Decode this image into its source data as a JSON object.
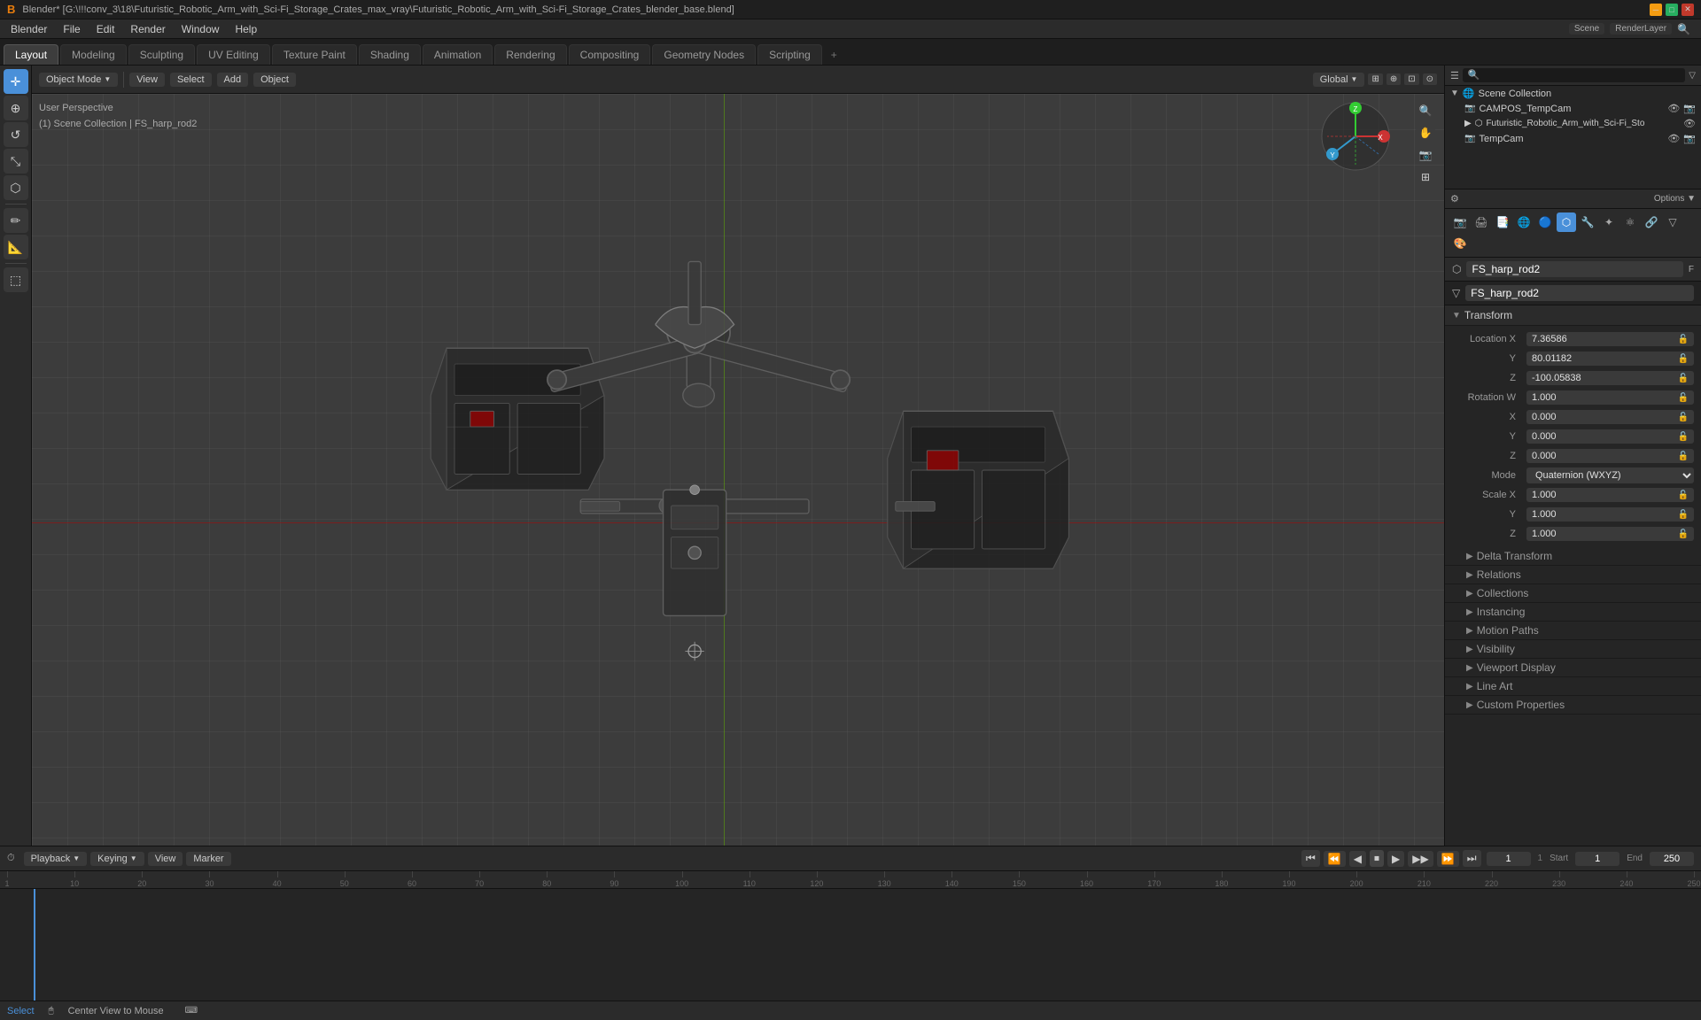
{
  "titlebar": {
    "logo": "B",
    "title": "Blender* [G:\\!!!conv_3\\18\\Futuristic_Robotic_Arm_with_Sci-Fi_Storage_Crates_max_vray\\Futuristic_Robotic_Arm_with_Sci-Fi_Storage_Crates_blender_base.blend]",
    "scene_label": "Scene",
    "render_layer": "RenderLayer"
  },
  "menubar": {
    "items": [
      "Blender",
      "File",
      "Edit",
      "Render",
      "Window",
      "Help"
    ]
  },
  "workspace_tabs": {
    "tabs": [
      "Layout",
      "Modeling",
      "Sculpting",
      "UV Editing",
      "Texture Paint",
      "Shading",
      "Animation",
      "Rendering",
      "Compositing",
      "Geometry Nodes",
      "Scripting"
    ],
    "active": "Layout",
    "add_label": "+"
  },
  "viewport_header": {
    "mode": "Object Mode",
    "view_label": "View",
    "select_label": "Select",
    "add_label": "Add",
    "object_label": "Object",
    "global_label": "Global",
    "perspective": "User Perspective",
    "collection": "(1) Scene Collection | FS_harp_rod2"
  },
  "left_toolbar": {
    "tools": [
      {
        "name": "cursor-tool",
        "icon": "✛",
        "active": true
      },
      {
        "name": "move-tool",
        "icon": "⊕",
        "active": false
      },
      {
        "name": "rotate-tool",
        "icon": "↺",
        "active": false
      },
      {
        "name": "scale-tool",
        "icon": "⤡",
        "active": false
      },
      {
        "name": "transform-tool",
        "icon": "⬡",
        "active": false
      },
      {
        "name": "annotate-tool",
        "icon": "✏",
        "active": false
      },
      {
        "name": "measure-tool",
        "icon": "📏",
        "active": false
      },
      {
        "name": "add-tool",
        "icon": "+",
        "active": false
      }
    ]
  },
  "outliner": {
    "search_placeholder": "🔍",
    "items": [
      {
        "name": "Scene Collection",
        "indent": 0,
        "icon": "📁",
        "has_eye": true,
        "has_cam": false
      },
      {
        "name": "CAMPOS_TempCam",
        "indent": 1,
        "icon": "📷",
        "has_eye": true,
        "has_cam": true
      },
      {
        "name": "Futuristic_Robotic_Arm_with_Sci-Fi_Sto",
        "indent": 1,
        "icon": "▶",
        "has_eye": true,
        "has_cam": false,
        "selected": false
      },
      {
        "name": "TempCam",
        "indent": 1,
        "icon": "📷",
        "has_eye": true,
        "has_cam": true
      }
    ]
  },
  "properties": {
    "object_name": "FS_harp_rod2",
    "mesh_name": "FS_harp_rod2",
    "sections": {
      "transform": {
        "label": "Transform",
        "expanded": true,
        "fields": [
          {
            "label": "Location X",
            "value": "7.36586",
            "axis": "X"
          },
          {
            "label": "Y",
            "value": "80.01182",
            "axis": "Y"
          },
          {
            "label": "Z",
            "value": "-100.05838",
            "axis": "Z"
          },
          {
            "label": "Rotation W",
            "value": "1.000",
            "axis": "W"
          },
          {
            "label": "X",
            "value": "0.000",
            "axis": "X"
          },
          {
            "label": "Y",
            "value": "0.000",
            "axis": "Y"
          },
          {
            "label": "Z",
            "value": "0.000",
            "axis": "Z"
          },
          {
            "label": "Mode",
            "value": "Quaternion (WXYZ)",
            "is_select": true
          },
          {
            "label": "Scale X",
            "value": "1.000",
            "axis": "X"
          },
          {
            "label": "Y",
            "value": "1.000",
            "axis": "Y"
          },
          {
            "label": "Z",
            "value": "1.000",
            "axis": "Z"
          }
        ]
      }
    },
    "collapsed_sections": [
      {
        "name": "delta-transform",
        "label": "Delta Transform"
      },
      {
        "name": "relations",
        "label": "Relations"
      },
      {
        "name": "collections",
        "label": "Collections"
      },
      {
        "name": "instancing",
        "label": "Instancing"
      },
      {
        "name": "motion-paths",
        "label": "Motion Paths"
      },
      {
        "name": "visibility",
        "label": "Visibility"
      },
      {
        "name": "viewport-display",
        "label": "Viewport Display"
      },
      {
        "name": "line-art",
        "label": "Line Art"
      },
      {
        "name": "custom-properties",
        "label": "Custom Properties"
      }
    ]
  },
  "timeline": {
    "playback_label": "Playback",
    "keying_label": "Keying",
    "view_label": "View",
    "marker_label": "Marker",
    "current_frame": "1",
    "start_frame": "1",
    "end_frame": "250",
    "ticks": [
      1,
      10,
      20,
      30,
      40,
      50,
      60,
      70,
      80,
      90,
      100,
      110,
      120,
      130,
      140,
      150,
      160,
      170,
      180,
      190,
      200,
      210,
      220,
      230,
      240,
      250
    ]
  },
  "statusbar": {
    "select_label": "Select",
    "hint_label": "Center View to Mouse"
  },
  "colors": {
    "accent": "#4a90d9",
    "bg_dark": "#1a1a1a",
    "bg_mid": "#252525",
    "bg_light": "#2b2b2b",
    "text_primary": "#cccccc",
    "text_secondary": "#999999",
    "orange": "#e87d0d"
  }
}
